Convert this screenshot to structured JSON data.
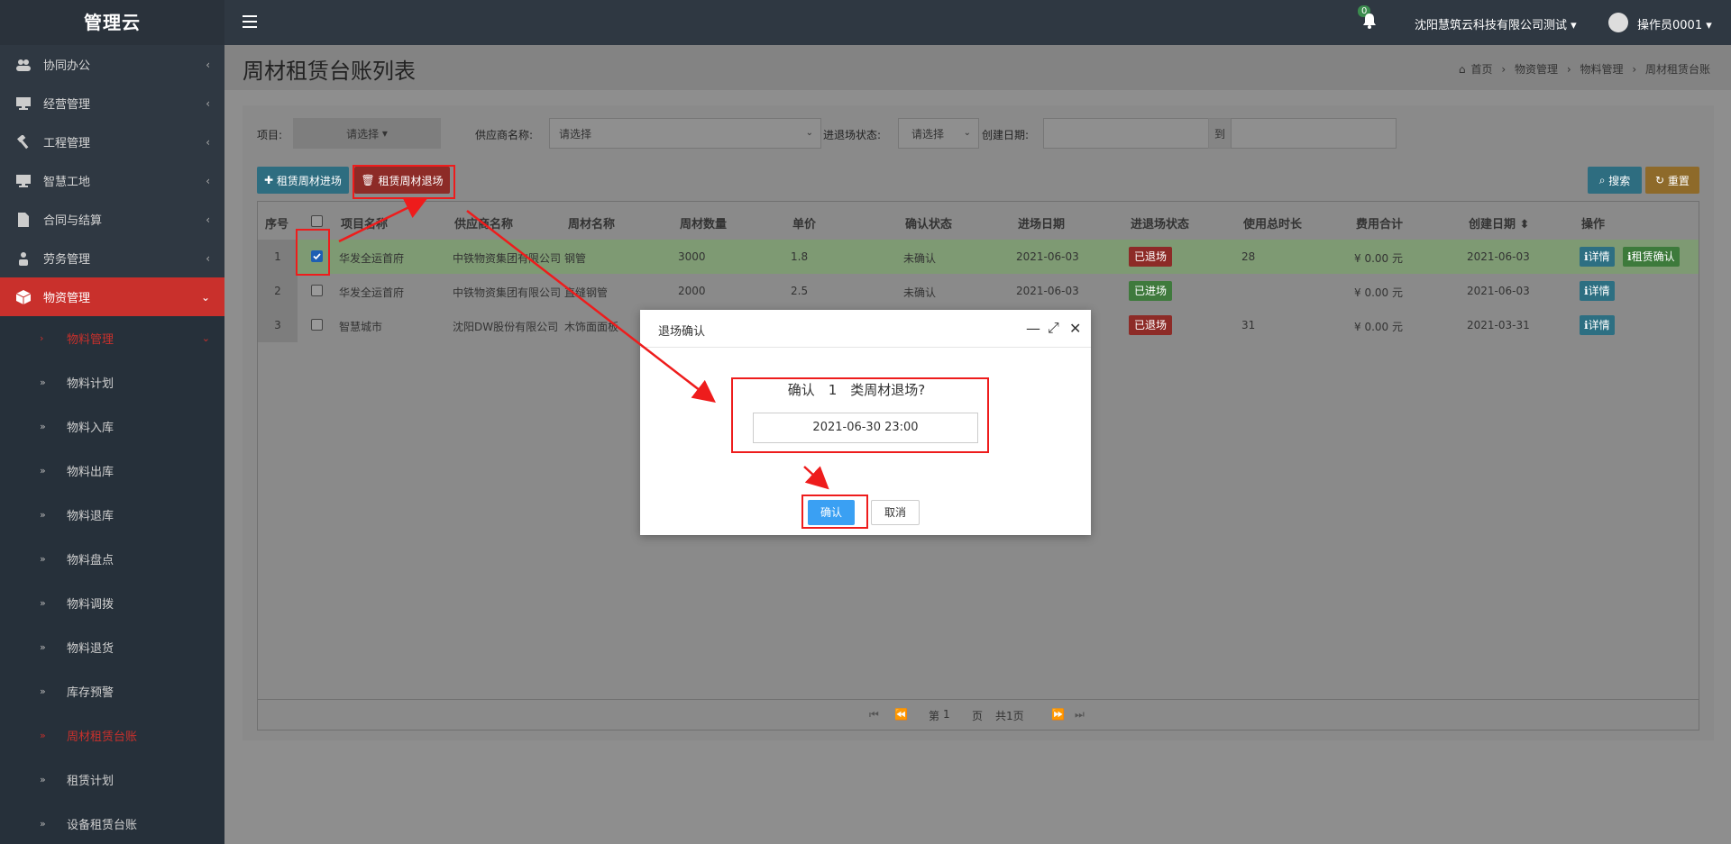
{
  "app": {
    "logo": "管理云"
  },
  "header": {
    "notification_count": "0",
    "company": "沈阳慧筑云科技有限公司测试",
    "user": "操作员0001"
  },
  "sidebar": {
    "items": [
      {
        "label": "协同办公"
      },
      {
        "label": "经营管理"
      },
      {
        "label": "工程管理"
      },
      {
        "label": "智慧工地"
      },
      {
        "label": "合同与结算"
      },
      {
        "label": "劳务管理"
      },
      {
        "label": "物资管理"
      }
    ],
    "sub_items": [
      {
        "label": "物料管理"
      },
      {
        "label": "物料计划"
      },
      {
        "label": "物料入库"
      },
      {
        "label": "物料出库"
      },
      {
        "label": "物料退库"
      },
      {
        "label": "物料盘点"
      },
      {
        "label": "物料调拨"
      },
      {
        "label": "物料退货"
      },
      {
        "label": "库存预警"
      },
      {
        "label": "周材租赁台账"
      },
      {
        "label": "租赁计划"
      },
      {
        "label": "设备租赁台账"
      }
    ]
  },
  "page": {
    "title": "周材租赁台账列表",
    "breadcrumb": [
      "首页",
      "物资管理",
      "物料管理",
      "周材租赁台账"
    ]
  },
  "filters": {
    "project_label": "项目:",
    "project_value": "请选择",
    "supplier_label": "供应商名称:",
    "supplier_value": "请选择",
    "status_label": "进退场状态:",
    "status_value": "请选择",
    "date_label": "创建日期:",
    "date_to": "到"
  },
  "toolbar": {
    "enter_label": "租赁周材进场",
    "exit_label": "租赁周材退场",
    "search_label": "搜索",
    "reset_label": "重置"
  },
  "table": {
    "headers": [
      "序号",
      "项目名称",
      "供应商名称",
      "周材名称",
      "周材数量",
      "单价",
      "确认状态",
      "进场日期",
      "进退场状态",
      "使用总时长",
      "费用合计",
      "创建日期",
      "操作"
    ],
    "rows": [
      {
        "no": "1",
        "project": "华发全运首府",
        "supplier": "中铁物资集团有限公司",
        "material": "钢管",
        "qty": "3000",
        "price": "1.8",
        "confirm": "未确认",
        "enter_date": "2021-06-03",
        "status": "已退场",
        "duration": "28",
        "cost": "¥ 0.00 元",
        "created": "2021-06-03",
        "action1": "详情",
        "action2": "租赁确认"
      },
      {
        "no": "2",
        "project": "华发全运首府",
        "supplier": "中铁物资集团有限公司",
        "material": "直缝钢管",
        "qty": "2000",
        "price": "2.5",
        "confirm": "未确认",
        "enter_date": "2021-06-03",
        "status": "已进场",
        "duration": "",
        "cost": "¥ 0.00 元",
        "created": "2021-06-03",
        "action1": "详情"
      },
      {
        "no": "3",
        "project": "智慧城市",
        "supplier": "沈阳DW股份有限公司",
        "material": "木饰面面板",
        "qty": "",
        "price": "",
        "confirm": "",
        "enter_date": "",
        "status": "已退场",
        "duration": "31",
        "cost": "¥ 0.00 元",
        "created": "2021-03-31",
        "action1": "详情"
      }
    ]
  },
  "pager": {
    "prefix": "第",
    "page": "1",
    "suffix": "页",
    "total": "共1页"
  },
  "modal": {
    "title": "退场确认",
    "confirm_text": "确认　1　类周材退场?",
    "date_value": "2021-06-30 23:00",
    "ok_label": "确认",
    "cancel_label": "取消"
  },
  "colors": {
    "annotation": "#ee1c1c",
    "primary": "#3aa0f3",
    "danger": "#c9302c"
  }
}
